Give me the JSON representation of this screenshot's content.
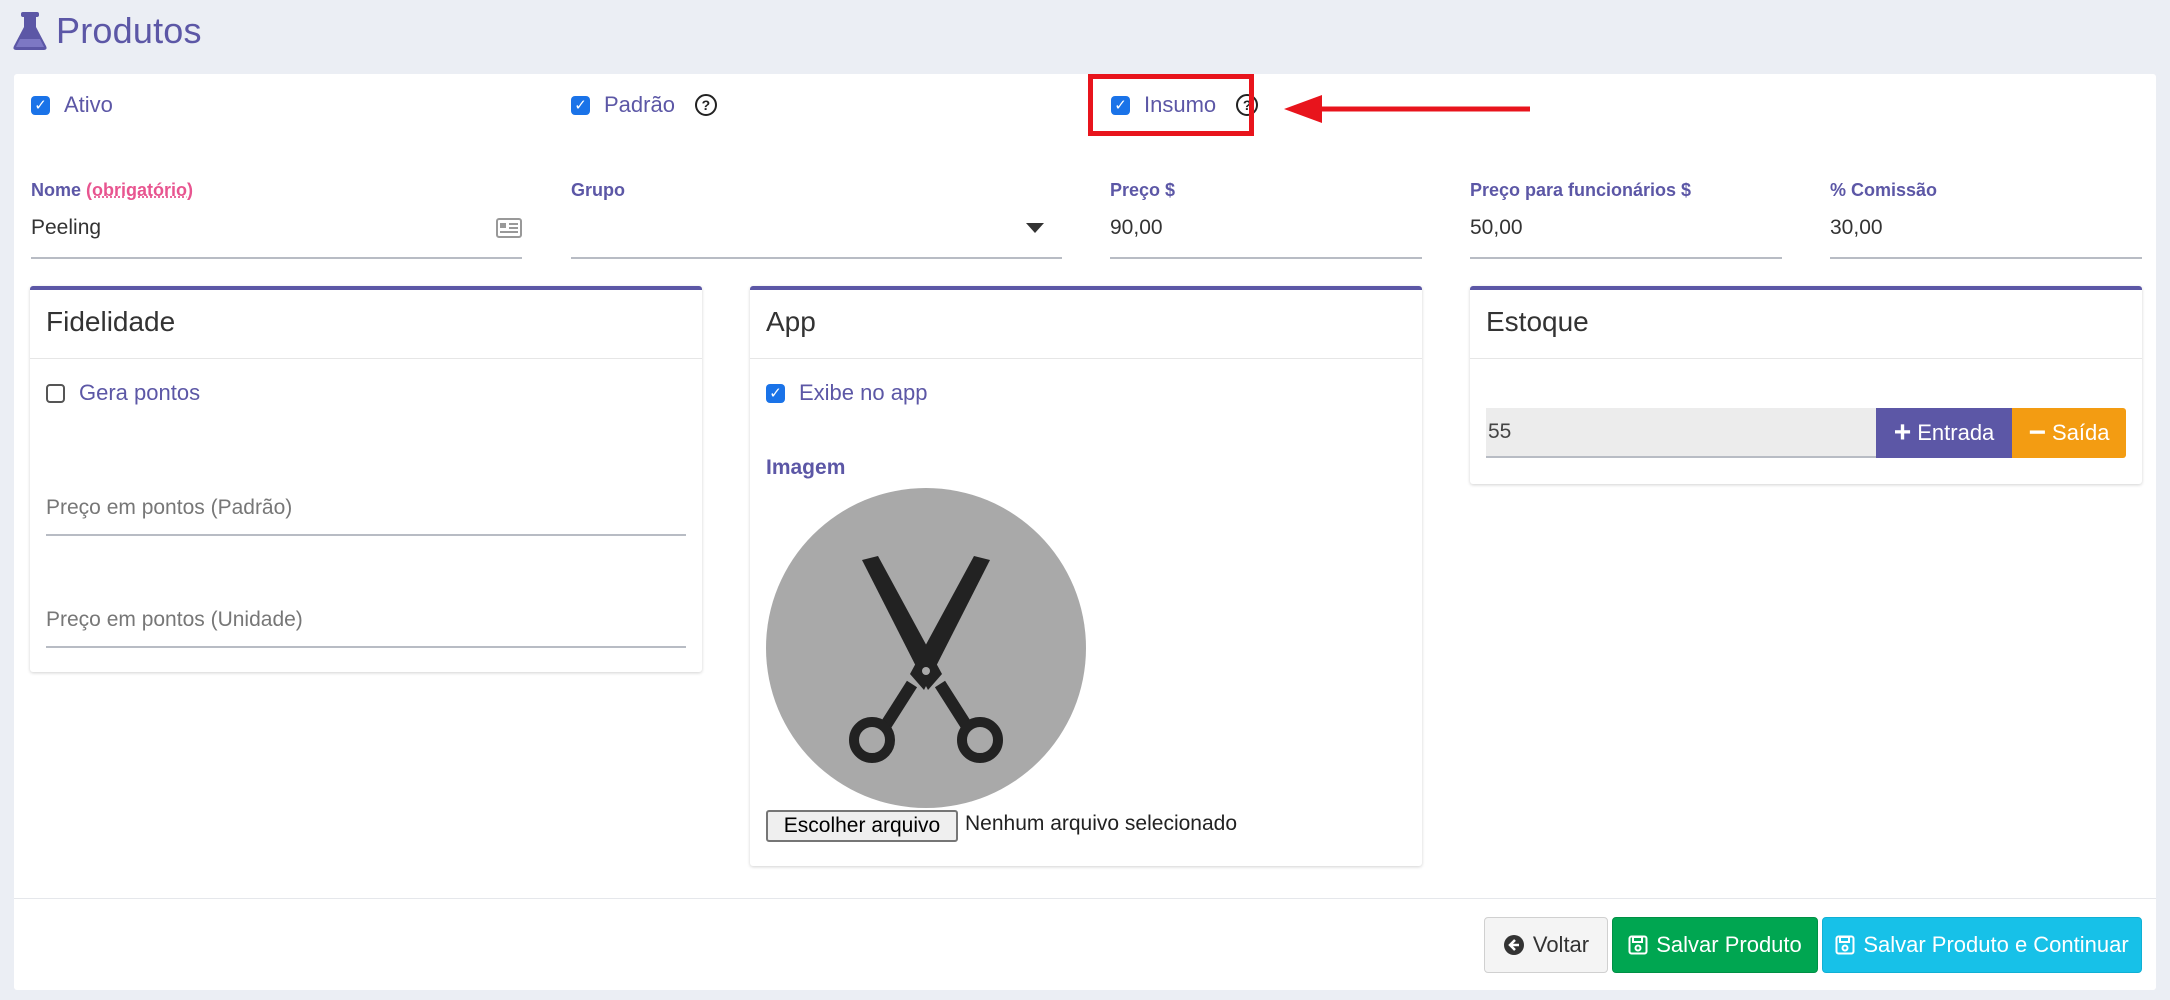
{
  "page": {
    "title": "Produtos",
    "icon": "flask-icon"
  },
  "flags": {
    "ativo": {
      "label": "Ativo",
      "checked": true
    },
    "padrao": {
      "label": "Padrão",
      "checked": true
    },
    "insumo": {
      "label": "Insumo",
      "checked": true
    }
  },
  "fields": {
    "nome": {
      "label": "Nome",
      "required": "(obrigatório)",
      "value": "Peeling"
    },
    "grupo": {
      "label": "Grupo",
      "value": ""
    },
    "preco": {
      "label": "Preço $",
      "value": "90,00"
    },
    "preco_func": {
      "label": "Preço para funcionários $",
      "value": "50,00"
    },
    "comissao": {
      "label": "% Comissão",
      "value": "30,00"
    }
  },
  "fidelidade": {
    "title": "Fidelidade",
    "gera_pontos": {
      "label": "Gera pontos",
      "checked": false
    },
    "preco_padrao_placeholder": "Preço em pontos (Padrão)",
    "preco_unidade_placeholder": "Preço em pontos (Unidade)"
  },
  "app": {
    "title": "App",
    "exibe": {
      "label": "Exibe no app",
      "checked": true
    },
    "imagem_label": "Imagem",
    "image_icon": "scissors-icon",
    "file_button": "Escolher arquivo",
    "file_status": "Nenhum arquivo selecionado"
  },
  "estoque": {
    "title": "Estoque",
    "value": "55",
    "entrada": "Entrada",
    "saida": "Saída"
  },
  "footer": {
    "voltar": "Voltar",
    "salvar": "Salvar Produto",
    "salvar_continuar": "Salvar Produto e Continuar"
  },
  "colors": {
    "primary": "#5c57a6",
    "success": "#00a651",
    "info": "#17c1e8",
    "warning": "#f39c12",
    "annotation": "#e8141c"
  }
}
